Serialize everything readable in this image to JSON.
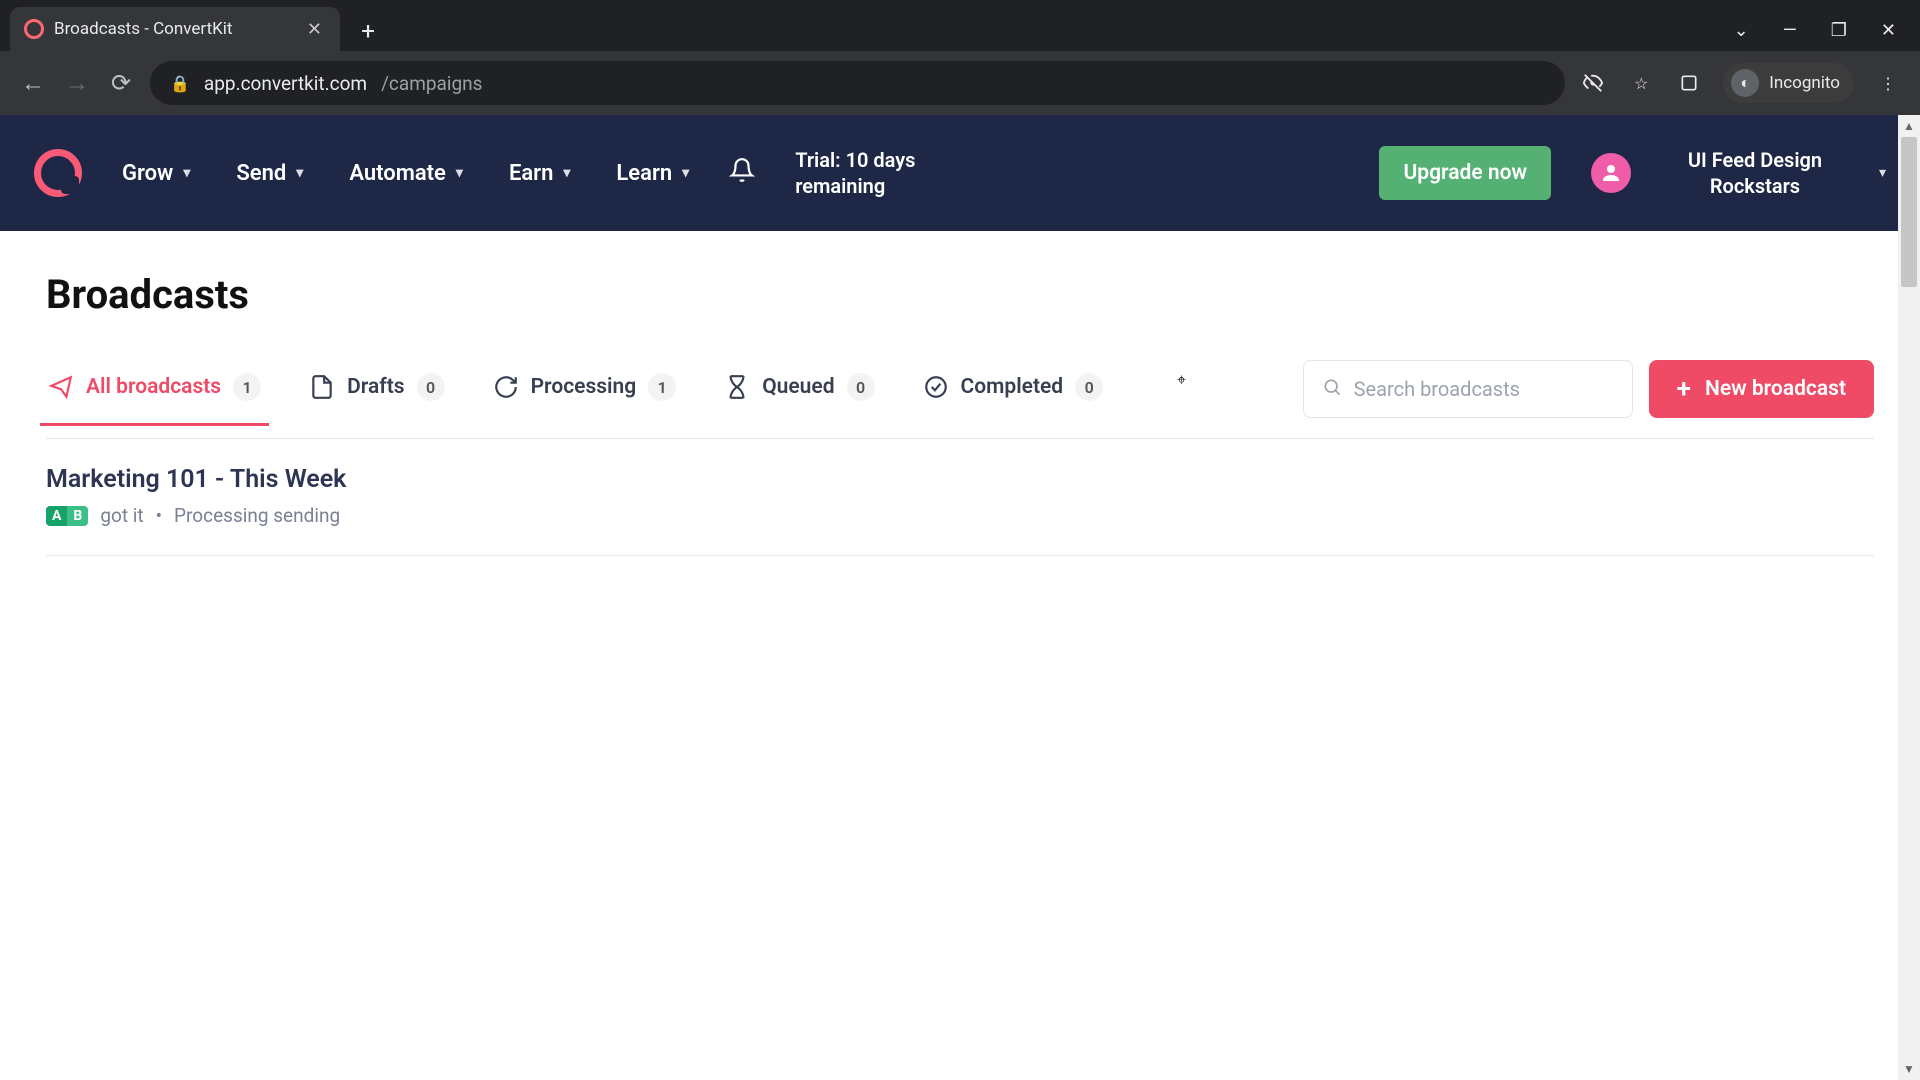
{
  "browser": {
    "tab_title": "Broadcasts - ConvertKit",
    "url_host": "app.convertkit.com",
    "url_path": "/campaigns",
    "incognito_label": "Incognito"
  },
  "header": {
    "nav": [
      "Grow",
      "Send",
      "Automate",
      "Earn",
      "Learn"
    ],
    "trial_text": "Trial: 10 days remaining",
    "upgrade_label": "Upgrade now",
    "account_name": "UI Feed Design Rockstars"
  },
  "page": {
    "title": "Broadcasts",
    "tabs": [
      {
        "key": "all",
        "label": "All broadcasts",
        "count": 1,
        "active": true
      },
      {
        "key": "drafts",
        "label": "Drafts",
        "count": 0,
        "active": false
      },
      {
        "key": "processing",
        "label": "Processing",
        "count": 1,
        "active": false
      },
      {
        "key": "queued",
        "label": "Queued",
        "count": 0,
        "active": false
      },
      {
        "key": "completed",
        "label": "Completed",
        "count": 0,
        "active": false
      }
    ],
    "search_placeholder": "Search broadcasts",
    "new_button": "New broadcast",
    "rows": [
      {
        "title": "Marketing 101 - This Week",
        "ab_test": true,
        "subject_preview": "got it",
        "status": "Processing sending"
      }
    ]
  },
  "colors": {
    "brand": "#ef4b66",
    "navbg": "#1f2747",
    "upgrade": "#55b074"
  }
}
